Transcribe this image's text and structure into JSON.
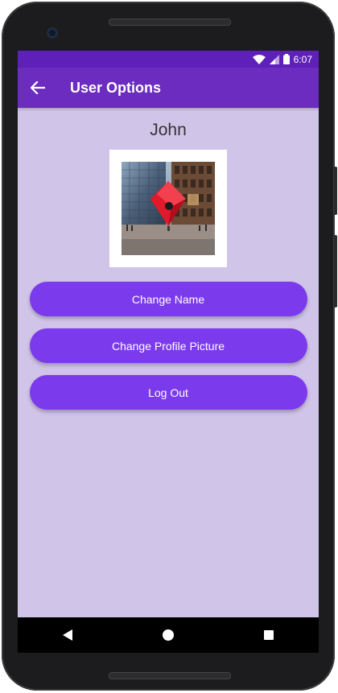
{
  "status_bar": {
    "time": "6:07",
    "icons": [
      "wifi-icon",
      "signal-icon",
      "battery-icon"
    ]
  },
  "app_bar": {
    "title": "User Options",
    "back_icon": "arrow-back-icon"
  },
  "profile": {
    "name": "John",
    "picture": "profile-picture"
  },
  "actions": {
    "change_name": "Change Name",
    "change_picture": "Change Profile Picture",
    "log_out": "Log Out"
  },
  "nav_bar": {
    "icons": [
      "back-triangle-icon",
      "home-circle-icon",
      "recents-square-icon"
    ]
  },
  "colors": {
    "status_bar": "#5e20b8",
    "app_bar": "#6b2cbf",
    "background": "#d1c4e9",
    "button": "#7c3aed"
  }
}
